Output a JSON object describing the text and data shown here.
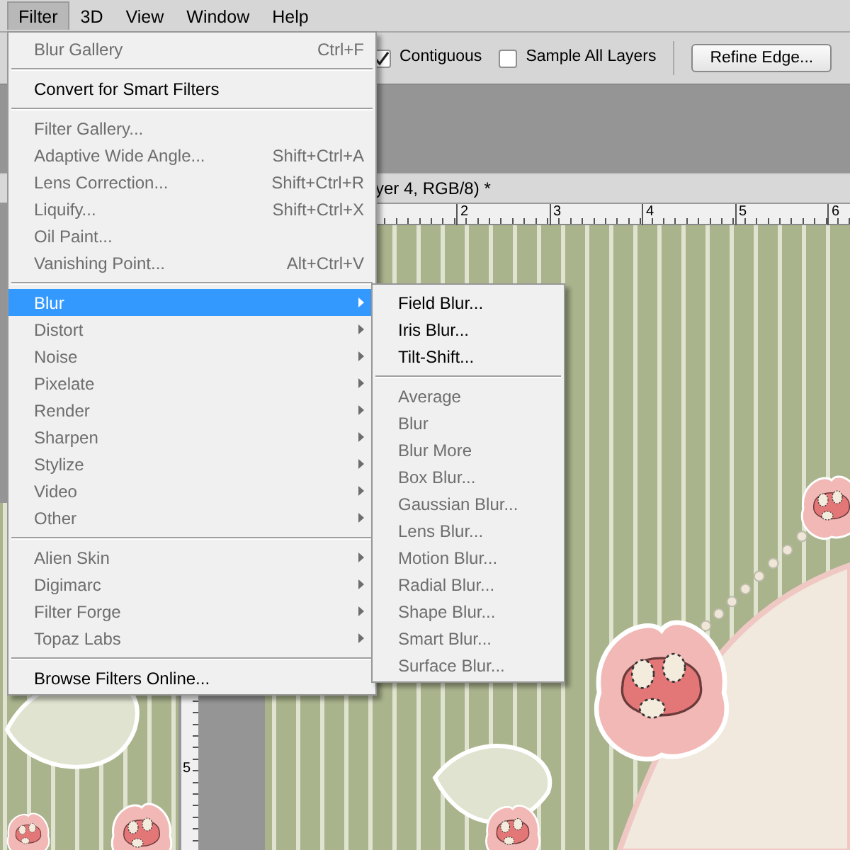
{
  "menubar": [
    {
      "label": "Filter",
      "selected": true
    },
    {
      "label": "3D",
      "selected": false
    },
    {
      "label": "View",
      "selected": false
    },
    {
      "label": "Window",
      "selected": false
    },
    {
      "label": "Help",
      "selected": false
    }
  ],
  "options_bar": {
    "checkboxes": [
      {
        "label": "Contiguous",
        "checked": true
      },
      {
        "label": "Sample All Layers",
        "checked": false
      }
    ],
    "refine_edge_button": "Refine Edge..."
  },
  "document_tab": {
    "title": "yer 4, RGB/8) *"
  },
  "top_ruler": {
    "labels": [
      "2",
      "3",
      "4",
      "5",
      "6"
    ]
  },
  "left_ruler": {
    "labels": [
      "5"
    ]
  },
  "filter_menu": {
    "groups": [
      [
        {
          "label": "Blur Gallery",
          "shortcut": "Ctrl+F",
          "disabled": true,
          "selected": false
        }
      ],
      [
        {
          "label": "Convert for Smart Filters",
          "disabled": false,
          "selected": false
        }
      ],
      [
        {
          "label": "Filter Gallery...",
          "disabled": true,
          "selected": false
        },
        {
          "label": "Adaptive Wide Angle...",
          "shortcut": "Shift+Ctrl+A",
          "disabled": true,
          "selected": false
        },
        {
          "label": "Lens Correction...",
          "shortcut": "Shift+Ctrl+R",
          "disabled": true,
          "selected": false
        },
        {
          "label": "Liquify...",
          "shortcut": "Shift+Ctrl+X",
          "disabled": true,
          "selected": false
        },
        {
          "label": "Oil Paint...",
          "disabled": true,
          "selected": false
        },
        {
          "label": "Vanishing Point...",
          "shortcut": "Alt+Ctrl+V",
          "disabled": true,
          "selected": false
        }
      ],
      [
        {
          "label": "Blur",
          "has_submenu": true,
          "disabled": false,
          "selected": true
        },
        {
          "label": "Distort",
          "has_submenu": true,
          "disabled": true,
          "selected": false
        },
        {
          "label": "Noise",
          "has_submenu": true,
          "disabled": true,
          "selected": false
        },
        {
          "label": "Pixelate",
          "has_submenu": true,
          "disabled": true,
          "selected": false
        },
        {
          "label": "Render",
          "has_submenu": true,
          "disabled": true,
          "selected": false
        },
        {
          "label": "Sharpen",
          "has_submenu": true,
          "disabled": true,
          "selected": false
        },
        {
          "label": "Stylize",
          "has_submenu": true,
          "disabled": true,
          "selected": false
        },
        {
          "label": "Video",
          "has_submenu": true,
          "disabled": true,
          "selected": false
        },
        {
          "label": "Other",
          "has_submenu": true,
          "disabled": true,
          "selected": false
        }
      ],
      [
        {
          "label": "Alien Skin",
          "has_submenu": true,
          "disabled": true,
          "selected": false
        },
        {
          "label": "Digimarc",
          "has_submenu": true,
          "disabled": true,
          "selected": false
        },
        {
          "label": "Filter Forge",
          "has_submenu": true,
          "disabled": true,
          "selected": false
        },
        {
          "label": "Topaz Labs",
          "has_submenu": true,
          "disabled": true,
          "selected": false
        }
      ],
      [
        {
          "label": "Browse Filters Online...",
          "disabled": false,
          "selected": false
        }
      ]
    ]
  },
  "blur_submenu": {
    "groups": [
      [
        {
          "label": "Field Blur...",
          "disabled": false,
          "selected": false
        },
        {
          "label": "Iris Blur...",
          "disabled": false,
          "selected": false
        },
        {
          "label": "Tilt-Shift...",
          "disabled": false,
          "selected": false
        }
      ],
      [
        {
          "label": "Average",
          "disabled": true,
          "selected": false
        },
        {
          "label": "Blur",
          "disabled": true,
          "selected": false
        },
        {
          "label": "Blur More",
          "disabled": true,
          "selected": false
        },
        {
          "label": "Box Blur...",
          "disabled": true,
          "selected": false
        },
        {
          "label": "Gaussian Blur...",
          "disabled": true,
          "selected": false
        },
        {
          "label": "Lens Blur...",
          "disabled": true,
          "selected": false
        },
        {
          "label": "Motion Blur...",
          "disabled": true,
          "selected": false
        },
        {
          "label": "Radial Blur...",
          "disabled": true,
          "selected": false
        },
        {
          "label": "Shape Blur...",
          "disabled": true,
          "selected": false
        },
        {
          "label": "Smart Blur...",
          "disabled": true,
          "selected": false
        },
        {
          "label": "Surface Blur...",
          "disabled": true,
          "selected": false
        }
      ]
    ]
  }
}
